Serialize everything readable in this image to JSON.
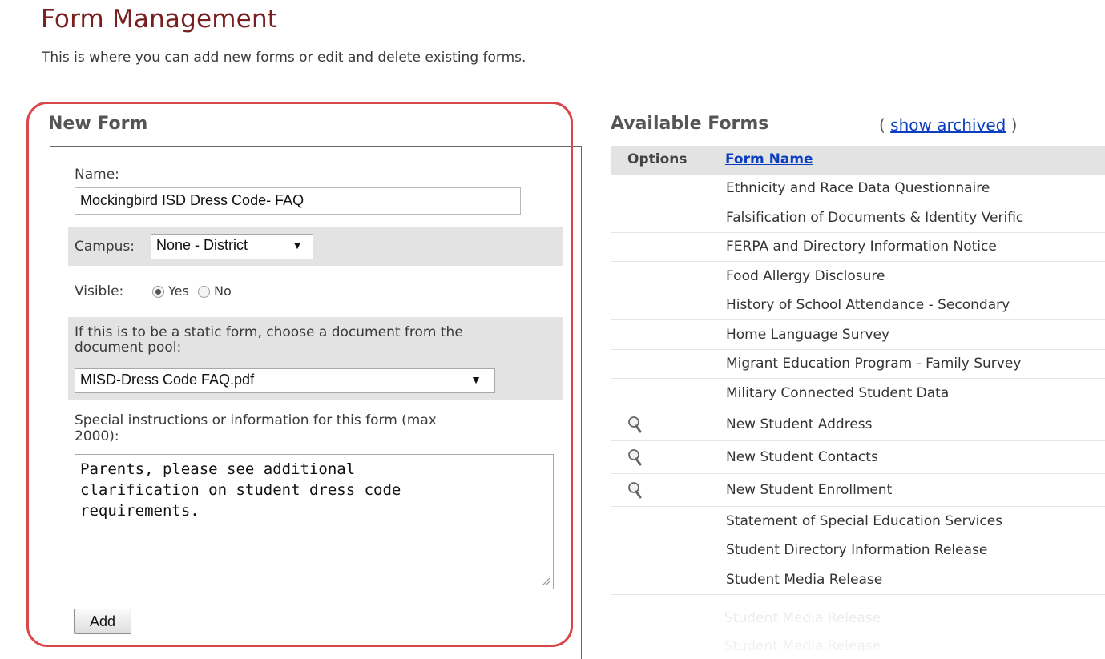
{
  "page": {
    "title": "Form Management",
    "subtitle": "This is where you can add new forms or edit and delete existing forms."
  },
  "new_form": {
    "heading": "New Form",
    "name_label": "Name:",
    "name_value": "Mockingbird ISD Dress Code- FAQ",
    "campus_label": "Campus:",
    "campus_value": "None - District",
    "visible_label": "Visible:",
    "visible_yes": "Yes",
    "visible_no": "No",
    "visible_selected": "Yes",
    "static_label_line1": "If this is to be a static form, choose a document from the",
    "static_label_line2": "document pool:",
    "document_value": "MISD-Dress Code FAQ.pdf",
    "instructions_label_line1": "Special instructions or information for this form (max",
    "instructions_label_line2": "2000):",
    "instructions_value": "Parents, please see additional\nclarification on student dress code\nrequirements.",
    "add_label": "Add",
    "dropdown_arrow": "▼"
  },
  "available_forms": {
    "heading": "Available Forms",
    "archived_open": "( ",
    "archived_link": "show archived",
    "archived_close": " )",
    "col_options": "Options",
    "col_form_name": "Form Name",
    "rows": [
      {
        "name": "Ethnicity and Race Data Questionnaire",
        "icon": null
      },
      {
        "name": "Falsification of Documents & Identity Verific",
        "icon": null
      },
      {
        "name": "FERPA and Directory Information Notice",
        "icon": null
      },
      {
        "name": "Food Allergy Disclosure",
        "icon": null
      },
      {
        "name": "History of School Attendance - Secondary",
        "icon": null
      },
      {
        "name": "Home Language Survey",
        "icon": null
      },
      {
        "name": "Migrant Education Program - Family Survey",
        "icon": null
      },
      {
        "name": "Military Connected Student Data",
        "icon": null
      },
      {
        "name": "New Student Address",
        "icon": "magnifier-icon"
      },
      {
        "name": "New Student Contacts",
        "icon": "magnifier-icon"
      },
      {
        "name": "New Student Enrollment",
        "icon": "magnifier-icon"
      },
      {
        "name": "Statement of Special Education Services",
        "icon": null
      },
      {
        "name": "Student Directory Information Release",
        "icon": null
      },
      {
        "name": "Student Media Release",
        "icon": null
      }
    ],
    "faded_rows": [
      "Student Media Release",
      "Student Media Release"
    ]
  },
  "colors": {
    "title": "#7a1f1f",
    "highlight": "#d9474b",
    "link": "#0a3dbf",
    "band": "#e3e3e3"
  }
}
